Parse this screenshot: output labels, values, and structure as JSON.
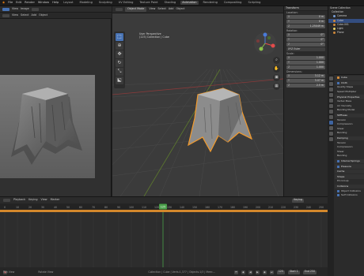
{
  "topbar": {
    "menus": [
      "File",
      "Edit",
      "Render",
      "Window",
      "Help"
    ],
    "workspaces": [
      "Layout",
      "Modeling",
      "Sculpting",
      "UV Editing",
      "Texture Paint",
      "Shading",
      "Animation",
      "Rendering",
      "Compositing",
      "Scripting"
    ],
    "active_workspace": "Animation"
  },
  "left_editor": {
    "header_items": [
      "View",
      "Image"
    ],
    "header2_items": [
      "View",
      "Select",
      "Add",
      "Object"
    ]
  },
  "viewport": {
    "mode": "Object Mode",
    "menus": [
      "View",
      "Select",
      "Add",
      "Object"
    ],
    "info_line1": "User Perspective",
    "info_line2": "(125) Collection | Cube",
    "tools": [
      "select",
      "cursor",
      "move",
      "rotate",
      "scale",
      "transform",
      "annotate",
      "measure"
    ],
    "gizmo": {
      "x_color": "#e44b4b",
      "y_color": "#8bc34a",
      "z_color": "#4a7bd8"
    }
  },
  "npanel": {
    "header": "Transform",
    "location_label": "Location:",
    "location": [
      {
        "axis": "X",
        "value": "0 m"
      },
      {
        "axis": "Y",
        "value": "0 m"
      },
      {
        "axis": "Z",
        "value": "1.25049 m"
      }
    ],
    "rotation_label": "Rotation:",
    "rotation": [
      {
        "axis": "X",
        "value": "0°"
      },
      {
        "axis": "Y",
        "value": "0°"
      },
      {
        "axis": "Z",
        "value": "0°"
      }
    ],
    "rotation_mode": "XYZ Euler",
    "scale_label": "Scale:",
    "scale": [
      {
        "axis": "X",
        "value": "1.000"
      },
      {
        "axis": "Y",
        "value": "1.000"
      },
      {
        "axis": "Z",
        "value": "1.000"
      }
    ],
    "dimensions_label": "Dimensions:",
    "dimensions": [
      {
        "axis": "X",
        "value": "3.12 m"
      },
      {
        "axis": "Y",
        "value": "3.07 m"
      },
      {
        "axis": "Z",
        "value": "2.5 m"
      }
    ]
  },
  "outliner": {
    "rows": [
      "Scene Collection",
      "Collection",
      "Camera",
      "Cube",
      "Cube.001",
      "Light",
      "Plane"
    ],
    "selected": "Cube"
  },
  "properties": {
    "object_name": "Cube",
    "sections": [
      "Cloth",
      "Quality Steps",
      "Speed Multiplier",
      "Physical Properties",
      "Vertex Mass",
      "Air Viscosity",
      "Bending Model",
      "Stiffness",
      "Tension",
      "Compression",
      "Shear",
      "Bending",
      "Damping",
      "Tension",
      "Compression",
      "Shear",
      "Bending",
      "Internal Springs",
      "Pressure",
      "Cache",
      "Shape",
      "Pin Group",
      "Collisions",
      "Object Collisions",
      "Self Collisions"
    ]
  },
  "timeline": {
    "menus": [
      "Playback",
      "Keying",
      "View",
      "Marker"
    ],
    "current_frame": "125",
    "ruler_labels": [
      "0",
      "10",
      "20",
      "30",
      "40",
      "50",
      "60",
      "70",
      "80",
      "90",
      "100",
      "110",
      "120",
      "130",
      "140",
      "150",
      "160",
      "170",
      "180",
      "190",
      "200",
      "210",
      "220",
      "230",
      "240",
      "250"
    ],
    "keying_set": "Keying",
    "start_label": "Start",
    "start": "1",
    "end_label": "End",
    "end": "250",
    "active_keying": "Keying"
  },
  "statusbar": {
    "left": "Pan View",
    "mid": "Rotate View",
    "right": "Collection | Cube | Verts:1,377 | Objects:1/3 | Mem:..."
  }
}
